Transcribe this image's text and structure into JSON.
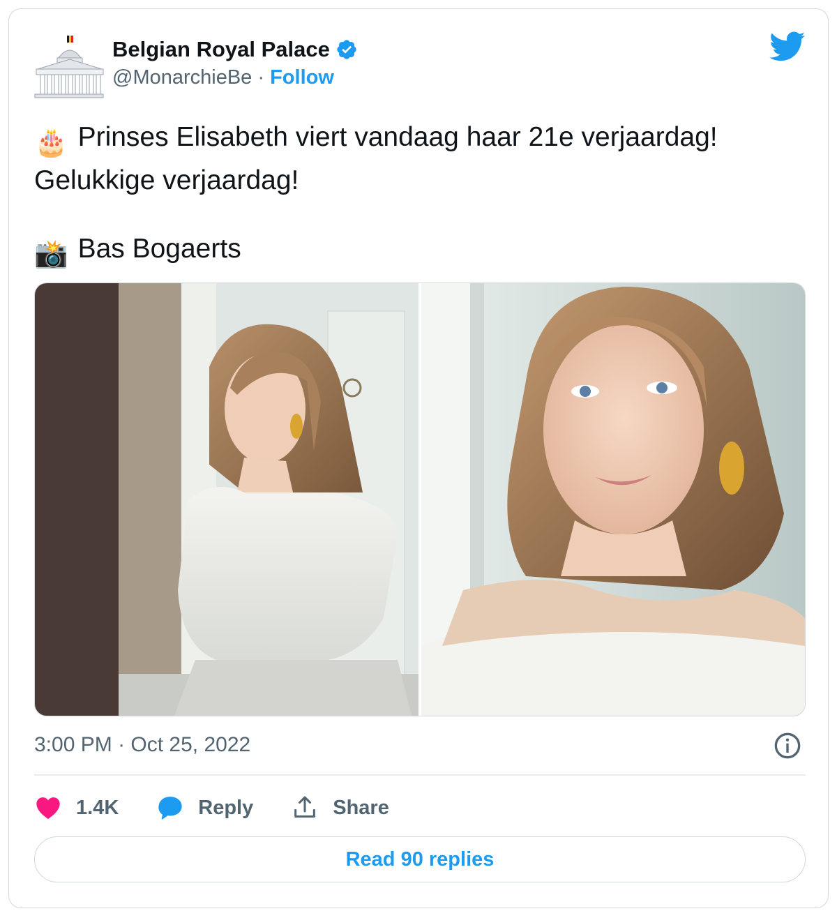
{
  "author": {
    "name": "Belgian Royal Palace",
    "handle": "@MonarchieBe",
    "separator": " · ",
    "follow_label": "Follow",
    "avatar_icon": "palace-building-icon",
    "verified_icon": "verified-badge-icon"
  },
  "tweet": {
    "line1_emoji": "🎂",
    "line1": "Prinses Elisabeth viert vandaag haar 21e verjaardag!",
    "line2": "Gelukkige verjaardag!",
    "credit_emoji": "📸",
    "credit": "Bas Bogaerts"
  },
  "meta": {
    "time": "3:00 PM",
    "separator": " · ",
    "date": "Oct 25, 2022"
  },
  "actions": {
    "likes": "1.4K",
    "reply_label": "Reply",
    "share_label": "Share"
  },
  "read_replies_label": "Read 90 replies",
  "colors": {
    "accent": "#1d9bf0",
    "like": "#f91880",
    "text": "#0f1419",
    "muted": "#536471",
    "border": "#cfd9de"
  }
}
